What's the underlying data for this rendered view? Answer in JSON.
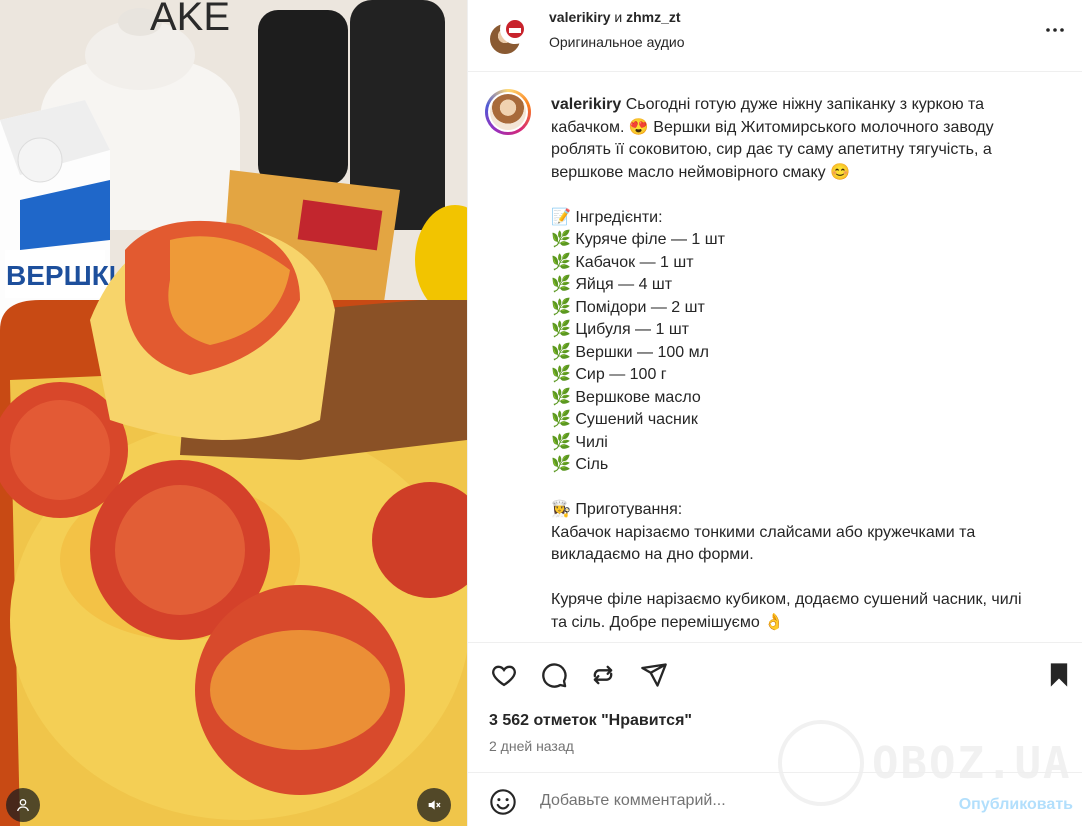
{
  "header": {
    "user1": "valerikiry",
    "and": "и",
    "user2": "zhmz_zt",
    "audio": "Оригинальное аудио",
    "more_icon": "more-horizontal-icon"
  },
  "caption": {
    "username": "valerikiry",
    "text": " Сьогодні готую дуже ніжну запіканку з куркою та кабачком. 😍 Вершки від Житомирського молочного заводу роблять її соковитою, сир дає ту саму апетитну тягучість, а вершкове масло неймовірного смаку 😊\n\n📝 Інгредієнти:\n🌿 Куряче філе — 1 шт\n🌿 Кабачок — 1 шт\n🌿 Яйця — 4 шт\n🌿 Помідори — 2 шт\n🌿 Цибуля — 1 шт\n🌿 Вершки — 100 мл\n🌿 Сир — 100 г\n🌿 Вершкове масло\n🌿 Сушений часник\n🌿 Чилі\n🌿 Сіль\n\n👩‍🍳 Приготування:\nКабачок нарізаємо тонкими слайсами або кружечками та викладаємо на дно форми.\n\nКуряче філе нарізаємо кубиком, додаємо сушений часник, чилі та сіль. Добре перемішуємо 👌"
  },
  "actions": {
    "like_icon": "heart-icon",
    "comment_icon": "comment-icon",
    "repost_icon": "repost-icon",
    "share_icon": "send-icon",
    "save_icon": "bookmark-icon"
  },
  "likes": "3 562 отметок \"Нравится\"",
  "date": "2 дней назад",
  "comment": {
    "placeholder": "Добавьте комментарий...",
    "publish": "Опубликовать",
    "emoji_icon": "emoji-icon"
  },
  "media": {
    "carton_brand": "ВЕРШКИ",
    "tagged_icon": "user-tag-icon",
    "mute_icon": "muted-speaker-icon"
  },
  "watermark": "OBOZ.UA",
  "colors": {
    "publish_disabled": "#b2dffc",
    "secondary_text": "#737373",
    "primary_text": "#262626"
  }
}
